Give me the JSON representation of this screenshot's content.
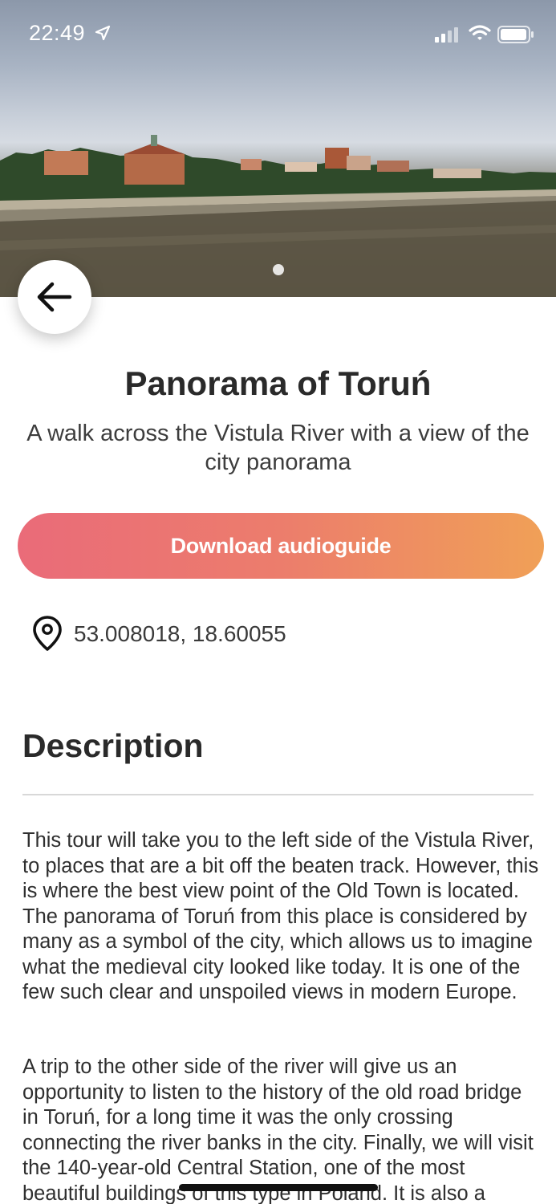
{
  "status_bar": {
    "time": "22:49"
  },
  "place": {
    "title": "Panorama of Toruń",
    "subtitle": "A walk across the Vistula River with a view of the city panorama",
    "download_label": "Download audioguide",
    "coordinates": "53.008018, 18.60055"
  },
  "description": {
    "heading": "Description",
    "paragraphs": [
      "This tour will take you to the left side of the Vistula River, to places that are a bit off the beaten track. However, this is where the best view point of the Old Town is located. The panorama of Toruń from this place is considered by many as a symbol of the city, which allows us to imagine what the medieval city looked like today. It is one of the few such clear and unspoiled views in modern Europe.",
      "A trip to the other side of the river will give us an opportunity to listen to the history of the old road bridge in Toruń, for a long time it was the only crossing connecting the river banks in the city. Finally, we will visit the 140-year-old Central Station, one of the most beautiful buildings of this type in Poland. It is also a"
    ]
  },
  "icons": {
    "back": "arrow-left-icon",
    "location": "map-pin-icon",
    "status_location": "location-arrow-icon",
    "signal": "cellular-signal-icon",
    "wifi": "wifi-icon",
    "battery": "battery-icon"
  },
  "colors": {
    "button_gradient_start": "#ea6b79",
    "button_gradient_end": "#f0a057"
  }
}
